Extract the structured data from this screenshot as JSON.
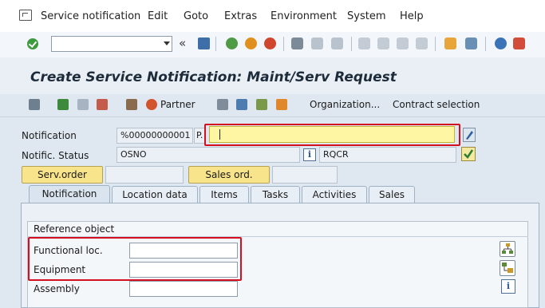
{
  "menu": [
    "Service notification",
    "Edit",
    "Goto",
    "Extras",
    "Environment",
    "System",
    "Help"
  ],
  "toolbar": {
    "command_value": "",
    "nav_arrows": "«",
    "icons": [
      "enter-check-icon",
      "save-icon",
      "back-icon",
      "exit-icon",
      "cancel-icon",
      "print-icon",
      "find-icon",
      "find-next-icon",
      "first-page-icon",
      "previous-page-icon",
      "next-page-icon",
      "last-page-icon",
      "new-session-icon",
      "shortcut-icon",
      "help-icon",
      "customize-layout-icon"
    ]
  },
  "title": "Create Service Notification: Maint/Serv Request",
  "app_toolbar": {
    "partner_label": "Partner",
    "organization_label": "Organization...",
    "contract_label": "Contract selection"
  },
  "form": {
    "notification_label": "Notification",
    "notification_value": "%00000000001",
    "notification_type": "P.",
    "description_value": "",
    "status_label": "Notific. Status",
    "status_value": "OSNO",
    "status_code": "RQCR",
    "serv_order_label": "Serv.order",
    "sales_ord_label": "Sales ord."
  },
  "tabs": [
    "Notification",
    "Location data",
    "Items",
    "Tasks",
    "Activities",
    "Sales"
  ],
  "active_tab": "Notification",
  "reference": {
    "title": "Reference object",
    "functional_loc_label": "Functional loc.",
    "functional_loc_value": "",
    "equipment_label": "Equipment",
    "equipment_value": "",
    "assembly_label": "Assembly",
    "assembly_value": ""
  },
  "info_glyph": "i",
  "colors": {
    "highlight_red": "#d40f1f",
    "title_blue": "#1d2b3a",
    "button_yellow": "#f8e48a"
  }
}
